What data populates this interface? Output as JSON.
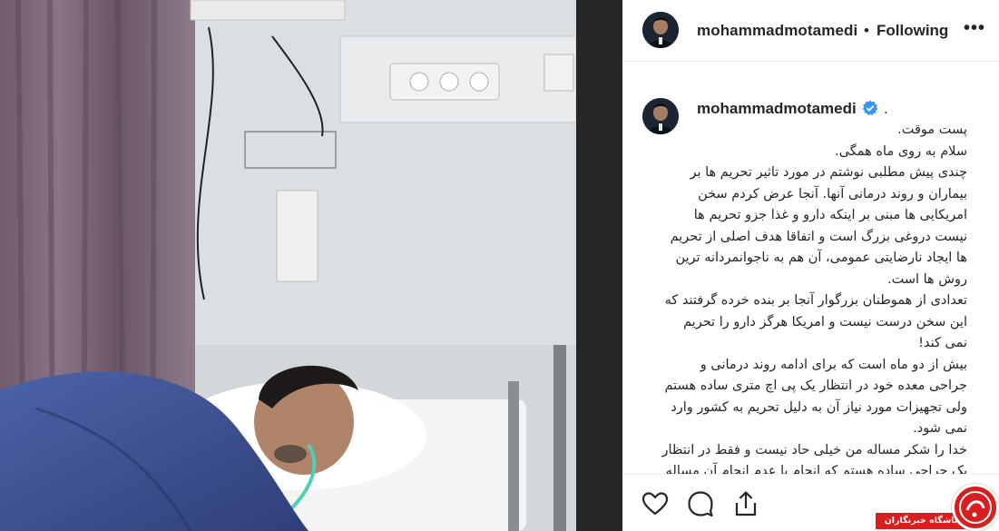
{
  "post": {
    "username": "mohammadmotamedi",
    "follow_status": "Following",
    "separator": "•",
    "more_label": "•••"
  },
  "caption": {
    "username": "mohammadmotamedi",
    "after_name": ".",
    "lines": [
      "پست موقت.",
      "سلام به روی ماه همگی.",
      "چندی پیش مطلبی نوشتم در مورد تاثیر تحریم ها بر بیماران و روند درمانی آنها. آنجا عرض کردم سخن امریکایی ها مبنی بر اینکه دارو و غذا جزو تحریم ها نیست دروغی بزرگ است و اتفاقا هدف اصلی از تحریم ها ایجاد نارضایتی عمومی، آن هم به ناجوانمردانه ترین روش ها است.",
      "تعدادی از هموطنان بزرگوار آنجا بر بنده خرده گرفتند که این سخن درست نیست و امریکا هرگز دارو را تحریم نمی کند!",
      "بیش از دو ماه است که برای ادامه روند درمانی و جراحی معده خود در انتظار یک پی اچ متری ساده هستم ولی تجهیزات مورد نیاز آن به دلیل تحریم به کشور وارد نمی شود.",
      "خدا را شکر مساله من خیلی حاد نیست و فقط در انتظار یک جراحی ساده هستم که انجام یا عدم انجام آن مساله مرگ و زندگی نیست. ولی بیماران بسیاری"
    ]
  },
  "watermark": {
    "text": "باشگاه خبرنگاران",
    "color": "#d81e1e"
  },
  "icons": [
    "more-icon",
    "verified-icon",
    "heart-icon",
    "comment-icon",
    "share-icon",
    "watermark-logo"
  ]
}
